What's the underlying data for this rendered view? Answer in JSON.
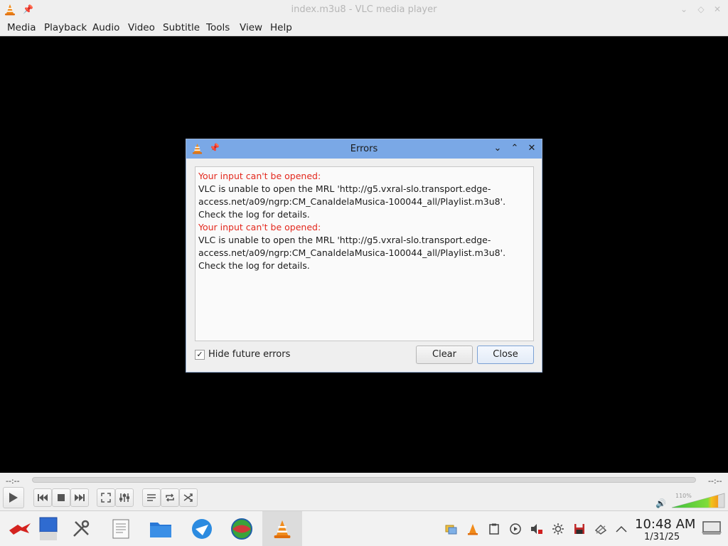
{
  "window": {
    "title": "index.m3u8 - VLC media player",
    "icons": {
      "app": "vlc-cone-icon",
      "pin": "pin-icon",
      "minimize": "chevron-down-icon",
      "maximize": "restore-icon",
      "close": "close-icon"
    }
  },
  "menubar": {
    "items": [
      "Media",
      "Playback",
      "Audio",
      "Video",
      "Subtitle",
      "Tools",
      "View",
      "Help"
    ]
  },
  "dialog": {
    "title": "Errors",
    "messages": [
      {
        "heading": "Your input can't be opened:",
        "body": "VLC is unable to open the MRL 'http://g5.vxral-slo.transport.edge-access.net/a09/ngrp:CM_CanaldelaMusica-100044_all/Playlist.m3u8'. Check the log for details."
      },
      {
        "heading": "Your input can't be opened:",
        "body": "VLC is unable to open the MRL 'http://g5.vxral-slo.transport.edge-access.net/a09/ngrp:CM_CanaldelaMusica-100044_all/Playlist.m3u8'. Check the log for details."
      }
    ],
    "hide_future_errors": {
      "label": "Hide future errors",
      "checked": true
    },
    "clear_label": "Clear",
    "close_label": "Close"
  },
  "controls": {
    "elapsed": "--:--",
    "remaining": "--:--",
    "volume_percent": "110%",
    "volume_level": 1.1
  },
  "taskbar": {
    "apps": [
      "app-launcher-icon",
      "desktop-icon",
      "settings-icon",
      "text-editor-icon",
      "file-manager-icon",
      "web-browser-icon",
      "globe-icon",
      "vlc-cone-icon"
    ],
    "active_app": "vlc-cone-icon",
    "tray_icons": [
      "notifications-icon",
      "vlc-cone-icon",
      "clipboard-icon",
      "media-player-icon",
      "audio-muted-icon",
      "brightness-icon",
      "save-icon",
      "network-icon",
      "expand-up-icon"
    ],
    "time": "10:48 AM",
    "date": "1/31/25"
  }
}
